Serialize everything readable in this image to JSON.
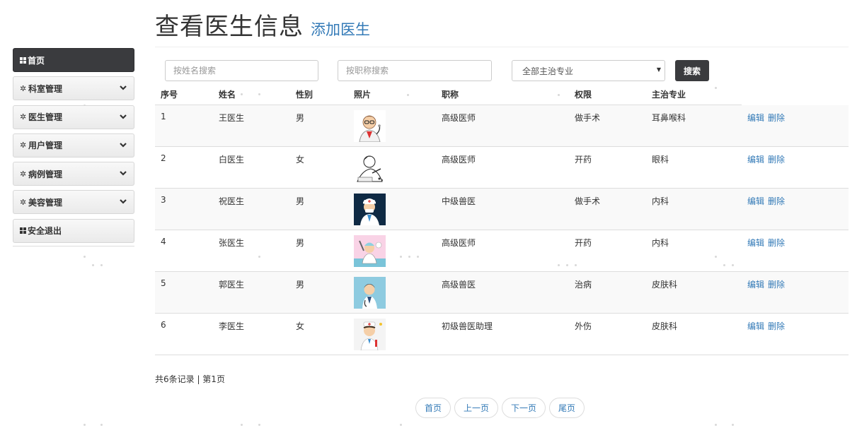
{
  "header": {
    "title": "查看医生信息",
    "add_link": "添加医生"
  },
  "sidebar": {
    "items": [
      {
        "label": "首页",
        "icon": "grid-icon",
        "active": true,
        "expandable": false
      },
      {
        "label": "科室管理",
        "icon": "gear-icon",
        "active": false,
        "expandable": true
      },
      {
        "label": "医生管理",
        "icon": "gear-icon",
        "active": false,
        "expandable": true
      },
      {
        "label": "用户管理",
        "icon": "gear-icon",
        "active": false,
        "expandable": true
      },
      {
        "label": "病例管理",
        "icon": "gear-icon",
        "active": false,
        "expandable": true
      },
      {
        "label": "美容管理",
        "icon": "gear-icon",
        "active": false,
        "expandable": true
      },
      {
        "label": "安全退出",
        "icon": "grid-icon",
        "active": false,
        "expandable": false
      }
    ]
  },
  "search": {
    "name_placeholder": "按姓名搜索",
    "title_placeholder": "按职称搜索",
    "specialty_selected": "全部主治专业",
    "button": "搜索"
  },
  "table": {
    "columns": [
      "序号",
      "姓名",
      "性别",
      "照片",
      "职称",
      "权限",
      "主治专业"
    ],
    "rows": [
      {
        "id": "1",
        "name": "王医生",
        "gender": "男",
        "photo": "doctor-glasses",
        "title": "高级医师",
        "permission": "做手术",
        "specialty": "耳鼻喉科"
      },
      {
        "id": "2",
        "name": "白医生",
        "gender": "女",
        "photo": "doctor-writing",
        "title": "高级医师",
        "permission": "开药",
        "specialty": "眼科"
      },
      {
        "id": "3",
        "name": "祝医生",
        "gender": "男",
        "photo": "doctor-dark",
        "title": "中级兽医",
        "permission": "做手术",
        "specialty": "内科"
      },
      {
        "id": "4",
        "name": "张医生",
        "gender": "男",
        "photo": "doctor-syringe",
        "title": "高级医师",
        "permission": "开药",
        "specialty": "内科"
      },
      {
        "id": "5",
        "name": "郭医生",
        "gender": "男",
        "photo": "doctor-blue",
        "title": "高级兽医",
        "permission": "治病",
        "specialty": "皮肤科"
      },
      {
        "id": "6",
        "name": "李医生",
        "gender": "女",
        "photo": "doctor-cartoon",
        "title": "初级兽医助理",
        "permission": "外伤",
        "specialty": "皮肤科"
      }
    ],
    "edit_label": "编辑",
    "delete_label": "删除"
  },
  "summary": {
    "text": "共6条记录 | 第1页"
  },
  "pagination": {
    "first": "首页",
    "prev": "上一页",
    "next": "下一页",
    "last": "尾页"
  },
  "colors": {
    "accent": "#337ab7",
    "dark": "#3a3b3e",
    "stripe": "#f9f9f9"
  }
}
